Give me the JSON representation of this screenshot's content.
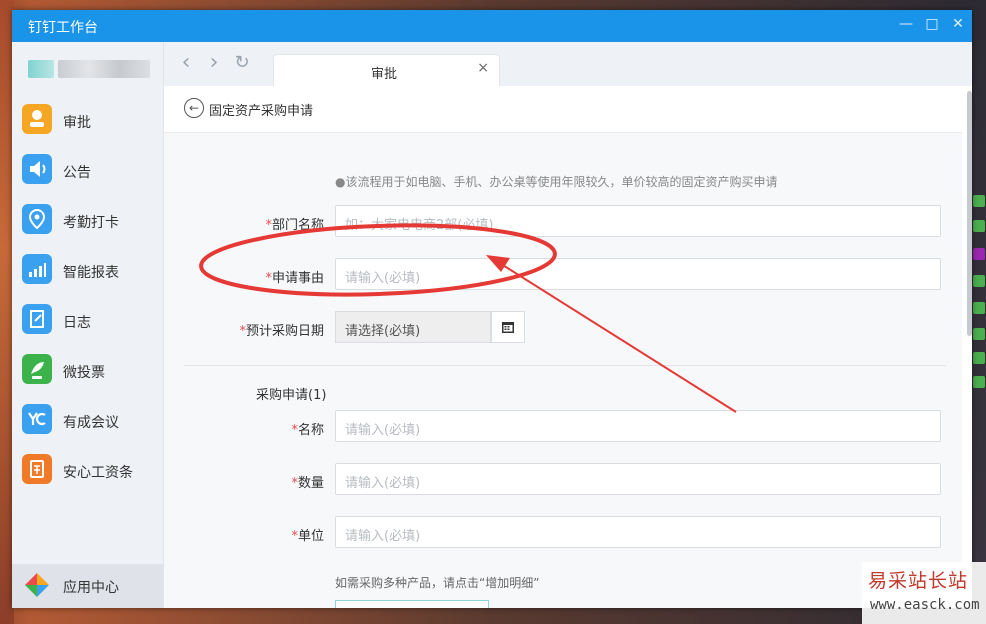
{
  "window": {
    "title": "钉钉工作台",
    "controls": {
      "minimize": "—",
      "maximize": "□",
      "close": "✕"
    }
  },
  "sidebar": {
    "items": [
      {
        "label": "审批",
        "icon": "approval-icon",
        "color": "#f5a623"
      },
      {
        "label": "公告",
        "icon": "megaphone-icon",
        "color": "#3aa0f0"
      },
      {
        "label": "考勤打卡",
        "icon": "location-pin-icon",
        "color": "#3aa0f0"
      },
      {
        "label": "智能报表",
        "icon": "bar-chart-icon",
        "color": "#3aa0f0"
      },
      {
        "label": "日志",
        "icon": "notebook-icon",
        "color": "#3aa0f0"
      },
      {
        "label": "微投票",
        "icon": "vote-icon",
        "color": "#3cb34a"
      },
      {
        "label": "有成会议",
        "icon": "meeting-icon",
        "color": "#3aa0f0"
      },
      {
        "label": "安心工资条",
        "icon": "payslip-icon",
        "color": "#f07a28"
      }
    ],
    "app_center": {
      "label": "应用中心",
      "icon": "app-center-icon"
    }
  },
  "browser": {
    "back": "‹",
    "forward": "›",
    "refresh": "↻",
    "tab": {
      "label": "审批",
      "close": "×"
    }
  },
  "page": {
    "breadcrumb": "固定资产采购申请",
    "notice": "●该流程用于如电脑、手机、办公桌等使用年限较久，单价较高的固定资产购买申请",
    "fields": {
      "department": {
        "label": "部门名称",
        "required": "*",
        "placeholder": "如：大家电电商2部(必填)"
      },
      "reason": {
        "label": "申请事由",
        "required": "*",
        "placeholder": "请输入(必填)"
      },
      "date": {
        "label": "预计采购日期",
        "required": "*",
        "placeholder": "请选择(必填)"
      }
    },
    "section_title": "采购申请(1)",
    "detail_fields": {
      "name": {
        "label": "名称",
        "required": "*",
        "placeholder": "请输入(必填)"
      },
      "quantity": {
        "label": "数量",
        "required": "*",
        "placeholder": "请输入(必填)"
      },
      "unit": {
        "label": "单位",
        "required": "*",
        "placeholder": "请输入(必填)"
      }
    },
    "add_hint": "如需采购多种产品，请点击“增加明细”"
  },
  "annotation": {
    "color": "#e53935"
  },
  "watermark": {
    "name": "易采站长站",
    "url": "www.easck.com"
  }
}
